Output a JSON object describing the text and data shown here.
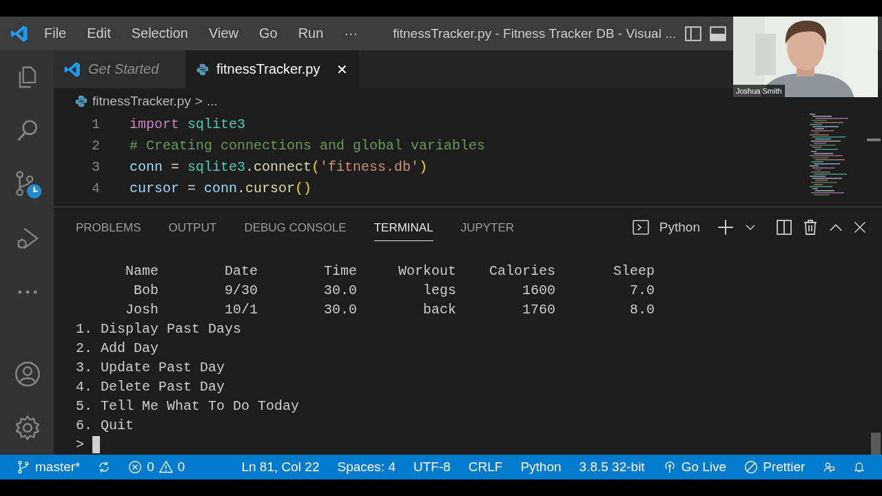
{
  "title_bar": {
    "menu": [
      "File",
      "Edit",
      "Selection",
      "View",
      "Go",
      "Run",
      "···"
    ],
    "title": "fitnessTracker.py - Fitness Tracker DB - Visual ..."
  },
  "activity_bar": {
    "items": [
      {
        "kind": "files",
        "selected": false
      },
      {
        "kind": "search",
        "selected": false
      },
      {
        "kind": "source-control",
        "selected": false
      },
      {
        "kind": "run",
        "selected": false
      },
      {
        "kind": "more",
        "selected": false
      }
    ],
    "bottom": [
      {
        "kind": "account"
      },
      {
        "kind": "settings"
      }
    ]
  },
  "tabs": [
    {
      "label": "Get Started",
      "kind": "welcome",
      "selected": false
    },
    {
      "label": "fitnessTracker.py",
      "kind": "python",
      "selected": true,
      "close": "✕"
    }
  ],
  "breadcrumb": {
    "file": "fitnessTracker.py",
    "separator": ">",
    "rest": "..."
  },
  "editor": {
    "lines": [
      {
        "number": "1",
        "tokens": [
          {
            "text": "import ",
            "kind": "keyword"
          },
          {
            "text": "sqlite3",
            "kind": "class"
          }
        ]
      },
      {
        "number": "2",
        "tokens": [
          {
            "text": "# Creating connections and global variables",
            "kind": "comment"
          }
        ]
      },
      {
        "number": "3",
        "tokens": [
          {
            "text": "conn",
            "kind": "variable"
          },
          {
            "text": " = ",
            "kind": "plain"
          },
          {
            "text": "sqlite3",
            "kind": "class"
          },
          {
            "text": ".",
            "kind": "plain"
          },
          {
            "text": "connect",
            "kind": "function"
          },
          {
            "text": "(",
            "kind": "bracket"
          },
          {
            "text": "'fitness.db'",
            "kind": "string"
          },
          {
            "text": ")",
            "kind": "bracket"
          }
        ]
      },
      {
        "number": "4",
        "tokens": [
          {
            "text": "cursor",
            "kind": "variable"
          },
          {
            "text": " = ",
            "kind": "plain"
          },
          {
            "text": "conn",
            "kind": "variable"
          },
          {
            "text": ".",
            "kind": "plain"
          },
          {
            "text": "cursor",
            "kind": "function"
          },
          {
            "text": "()",
            "kind": "bracket"
          }
        ]
      }
    ]
  },
  "webcam": {
    "kind": "picture",
    "name": "Joshua Smith"
  },
  "panel": {
    "tabs": [
      {
        "label": "PROBLEMS",
        "selected": false
      },
      {
        "label": "OUTPUT",
        "selected": false
      },
      {
        "label": "DEBUG CONSOLE",
        "selected": false
      },
      {
        "label": "TERMINAL",
        "selected": true
      },
      {
        "label": "JUPYTER",
        "selected": false
      }
    ],
    "terminal_name": "Python"
  },
  "terminal": {
    "table": {
      "columns": [
        "Name",
        "Date",
        "Time",
        "Workout",
        "Calories",
        "Sleep"
      ],
      "rows": [
        [
          "Bob",
          "9/30",
          "30.0",
          "legs",
          "1600",
          "7.0"
        ],
        [
          "Josh",
          "10/1",
          "30.0",
          "back",
          "1760",
          "8.0"
        ]
      ]
    },
    "lines": [
      "1. Display Past Days",
      "2. Add Day",
      "3. Update Past Day",
      "4. Delete Past Day",
      "5. Tell Me What To Do Today",
      "6. Quit"
    ],
    "prompt": ">"
  },
  "status_bar": {
    "branch": "master*",
    "errors": "0",
    "warnings": "0",
    "items": [
      "Ln 81, Col 22",
      "Spaces: 4",
      "UTF-8",
      "CRLF",
      "Python",
      "3.8.5 32-bit"
    ],
    "go_live": "Go Live",
    "prettier": "Prettier"
  }
}
